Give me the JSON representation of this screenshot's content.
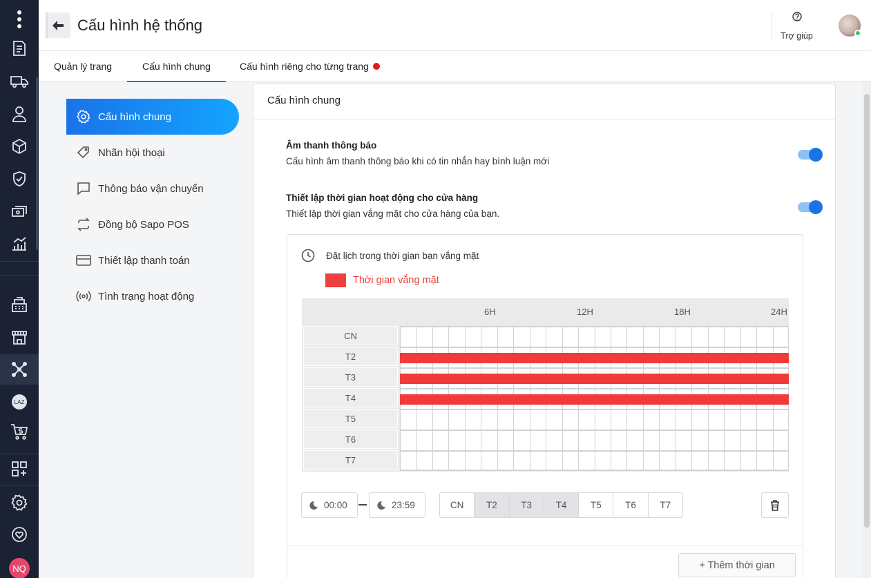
{
  "rail": {
    "items": [
      {
        "name": "orders-icon"
      },
      {
        "name": "shipping-truck-icon"
      },
      {
        "name": "customer-icon"
      },
      {
        "name": "product-box-icon"
      },
      {
        "name": "shield-check-icon"
      },
      {
        "name": "cashbook-icon"
      },
      {
        "name": "report-chart-icon"
      },
      {
        "name": "pos-register-icon"
      },
      {
        "name": "store-icon"
      },
      {
        "name": "social-connect-icon"
      },
      {
        "name": "lazada-icon",
        "text": "LAZ"
      },
      {
        "name": "shopee-cart-icon"
      },
      {
        "name": "apps-add-icon"
      },
      {
        "name": "settings-gear-icon"
      },
      {
        "name": "heart-support-icon"
      }
    ],
    "user_initials": "NQ"
  },
  "header": {
    "title": "Cấu hình hệ thống",
    "help_label": "Trợ giúp"
  },
  "tabs": [
    {
      "label": "Quản lý trang",
      "active": false
    },
    {
      "label": "Cấu hình chung",
      "active": true
    },
    {
      "label": "Cấu hình riêng cho từng trang",
      "active": false,
      "dot": true
    }
  ],
  "settings_menu": [
    {
      "label": "Cấu hình chung",
      "icon": "gear-icon",
      "active": true
    },
    {
      "label": "Nhãn hội thoại",
      "icon": "tag-icon",
      "active": false
    },
    {
      "label": "Thông báo vận chuyển",
      "icon": "message-icon",
      "active": false
    },
    {
      "label": "Đồng bộ Sapo POS",
      "icon": "sync-icon",
      "active": false
    },
    {
      "label": "Thiết lập thanh toán",
      "icon": "card-icon",
      "active": false
    },
    {
      "label": "Tình trạng hoạt động",
      "icon": "broadcast-icon",
      "active": false
    }
  ],
  "card": {
    "title": "Cấu hình chung",
    "sound": {
      "title": "Âm thanh thông báo",
      "desc": "Cấu hình âm thanh thông báo khi có tin nhắn hay bình luận mới",
      "enabled": true
    },
    "hours": {
      "title": "Thiết lập thời gian hoạt động cho cửa hàng",
      "desc": "Thiết lập thời gian vắng mặt cho cửa hàng của bạn.",
      "enabled": true
    }
  },
  "schedule": {
    "title": "Đặt lịch trong thời gian bạn vắng mặt",
    "legend": "Thời gian vắng mặt",
    "hour_labels": [
      "6H",
      "12H",
      "18H",
      "24H"
    ],
    "rows": [
      "CN",
      "T2",
      "T3",
      "T4",
      "T5",
      "T6",
      "T7"
    ],
    "absent_rows": [
      "T2",
      "T3",
      "T4"
    ],
    "start_time": "00:00",
    "end_time": "23:59",
    "days": [
      {
        "label": "CN",
        "selected": false
      },
      {
        "label": "T2",
        "selected": true
      },
      {
        "label": "T3",
        "selected": true
      },
      {
        "label": "T4",
        "selected": true
      },
      {
        "label": "T5",
        "selected": false
      },
      {
        "label": "T6",
        "selected": false
      },
      {
        "label": "T7",
        "selected": false
      }
    ],
    "add_label": "+ Thêm thời gian"
  },
  "colors": {
    "rail_bg": "#1a2233",
    "accent": "#1a73e8",
    "absent": "#f33a3a",
    "tab_dot": "#e31b1b"
  }
}
